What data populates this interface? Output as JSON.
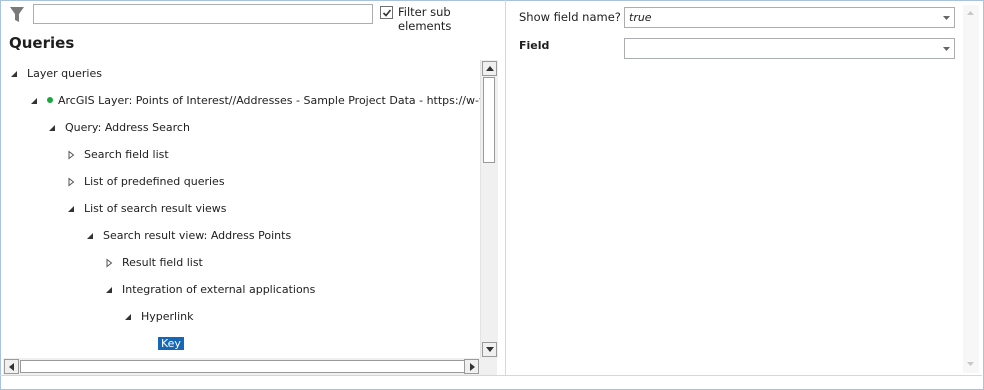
{
  "toolbar": {
    "filter_icon": "filter-funnel-icon",
    "filter_value": "",
    "filter_sub_checked": true,
    "filter_sub_label": "Filter sub elements"
  },
  "panel": {
    "title": "Queries"
  },
  "tree": {
    "nodes": [
      {
        "label": "Layer queries",
        "expanded": true,
        "depth": 0
      },
      {
        "label": "ArcGIS Layer: Points of Interest//Addresses - Sample Project Data - https://w-ws-and",
        "expanded": true,
        "depth": 1,
        "status": "active"
      },
      {
        "label": "Query: Address Search",
        "expanded": true,
        "depth": 2
      },
      {
        "label": "Search field list",
        "expanded": false,
        "depth": 3
      },
      {
        "label": "List of predefined queries",
        "expanded": false,
        "depth": 3
      },
      {
        "label": "List of search result views",
        "expanded": true,
        "depth": 3
      },
      {
        "label": "Search result view: Address Points",
        "expanded": true,
        "depth": 4
      },
      {
        "label": "Result field list",
        "expanded": false,
        "depth": 5
      },
      {
        "label": "Integration of external applications",
        "expanded": true,
        "depth": 5
      },
      {
        "label": "Hyperlink",
        "expanded": true,
        "depth": 6
      },
      {
        "label": "Key",
        "depth": 7,
        "selected": true
      }
    ]
  },
  "properties": {
    "show_field_name": {
      "label": "Show field name?",
      "value": "true"
    },
    "field": {
      "label": "Field",
      "value": ""
    }
  },
  "colors": {
    "selection": "#1668b6",
    "status_dot": "#1ba83c",
    "frame": "#a9c3dd"
  }
}
